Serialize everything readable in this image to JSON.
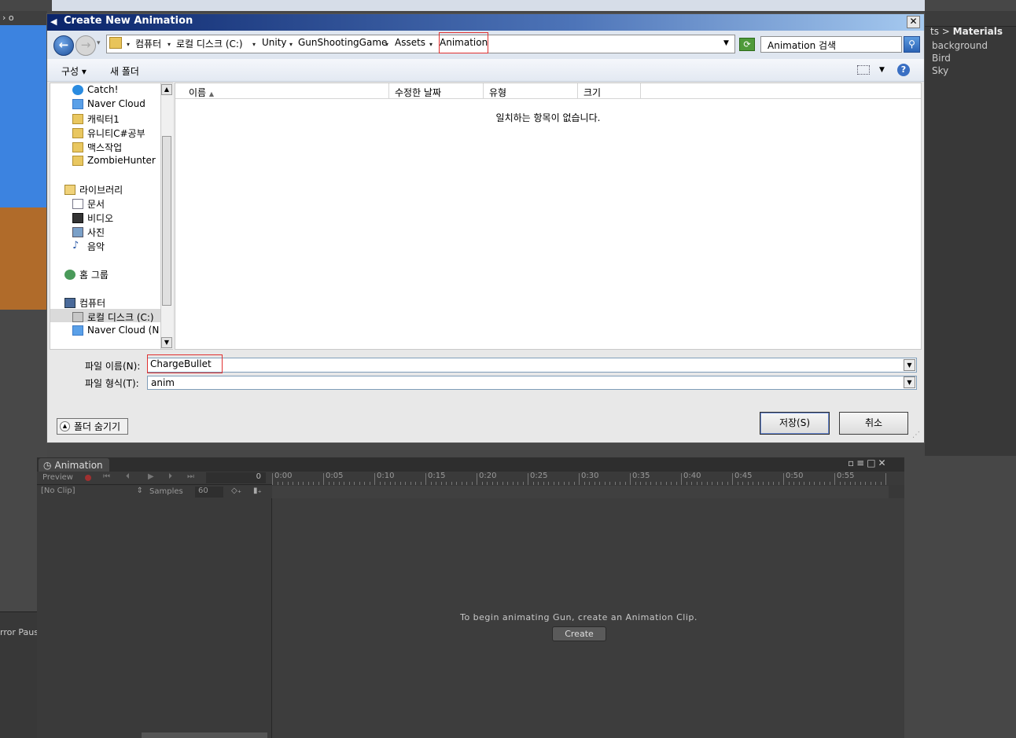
{
  "unity": {
    "left_tab_text": "› o",
    "error_pause": "rror Paus",
    "project": {
      "crumb_prefix": "ts",
      "crumb_current": "Materials",
      "items": [
        "background",
        "Bird",
        "Sky"
      ]
    },
    "animation": {
      "tab_label": "Animation",
      "preview_label": "Preview",
      "frame_value": "0",
      "clip_select": "[No Clip]",
      "samples_label": "Samples",
      "samples_value": "60",
      "ruler_ticks": [
        "0:00",
        "0:05",
        "0:10",
        "0:15",
        "0:20",
        "0:25",
        "0:30",
        "0:35",
        "0:40",
        "0:45",
        "0:50",
        "0:55"
      ],
      "message": "To begin animating Gun, create an Animation Clip.",
      "create_label": "Create"
    }
  },
  "dialog": {
    "title": "Create New Animation",
    "breadcrumbs": [
      "컴퓨터",
      "로컬 디스크 (C:)",
      "Unity",
      "GunShootingGame",
      "Assets",
      "Animation"
    ],
    "search_placeholder": "Animation 검색",
    "organize_label": "구성 ▾",
    "new_folder_label": "새 폴더",
    "nav_items": [
      {
        "label": "Catch!",
        "icon": "catch-icon"
      },
      {
        "label": "Naver Cloud",
        "icon": "cloud-icon"
      },
      {
        "label": "캐릭터1",
        "icon": "folder-icon"
      },
      {
        "label": "유니티C#공부",
        "icon": "folder-icon"
      },
      {
        "label": "맥스작업",
        "icon": "folder-icon"
      },
      {
        "label": "ZombieHunter",
        "icon": "folder-icon"
      },
      {
        "label": "라이브러리",
        "icon": "library-icon"
      },
      {
        "label": "문서",
        "icon": "document-icon"
      },
      {
        "label": "비디오",
        "icon": "video-icon"
      },
      {
        "label": "사진",
        "icon": "picture-icon"
      },
      {
        "label": "음악",
        "icon": "music-icon"
      },
      {
        "label": "홈 그룹",
        "icon": "homegroup-icon"
      },
      {
        "label": "컴퓨터",
        "icon": "computer-icon"
      },
      {
        "label": "로컬 디스크 (C:)",
        "icon": "drive-icon"
      },
      {
        "label": "Naver Cloud (N",
        "icon": "cloud-drive-icon"
      }
    ],
    "columns": [
      "이름",
      "수정한 날짜",
      "유형",
      "크기"
    ],
    "empty_message": "일치하는 항목이 없습니다.",
    "filename_label": "파일 이름(N):",
    "filename_value": "ChargeBullet",
    "filetype_label": "파일 형식(T):",
    "filetype_value": "anim",
    "hide_folders_label": "폴더 숨기기",
    "save_label": "저장(S)",
    "cancel_label": "취소"
  }
}
